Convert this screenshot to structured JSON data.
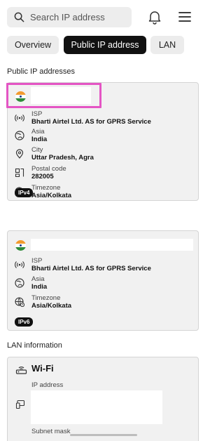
{
  "search": {
    "placeholder": "Search IP address"
  },
  "tabs": [
    {
      "label": "Overview",
      "active": false
    },
    {
      "label": "Public IP address",
      "active": true
    },
    {
      "label": "LAN",
      "active": false
    }
  ],
  "public_section": {
    "title": "Public IP addresses"
  },
  "ipv4_card": {
    "rows": [
      {
        "icon": "isp-icon",
        "label": "ISP",
        "value": "Bharti Airtel Ltd. AS for GPRS Service"
      },
      {
        "icon": "globe-icon",
        "label": "Asia",
        "value": "India"
      },
      {
        "icon": "location-pin-icon",
        "label": "City",
        "value": "Uttar Pradesh, Agra"
      },
      {
        "icon": "postal-code-icon",
        "label": "Postal code",
        "value": "282005"
      },
      {
        "icon": "timezone-icon",
        "label": "Timezone",
        "value": "Asia/Kolkata"
      }
    ],
    "badge": "IPv4"
  },
  "ipv6_card": {
    "rows": [
      {
        "icon": "isp-icon",
        "label": "ISP",
        "value": "Bharti Airtel Ltd. AS for GPRS Service"
      },
      {
        "icon": "globe-icon",
        "label": "Asia",
        "value": "India"
      },
      {
        "icon": "timezone-icon",
        "label": "Timezone",
        "value": "Asia/Kolkata"
      }
    ],
    "badge": "IPv6"
  },
  "lan_section": {
    "title": "LAN information"
  },
  "wifi_card": {
    "title": "Wi-Fi",
    "ip_label": "IP address",
    "subnet_label": "Subnet mask"
  },
  "colors": {
    "highlight": "#e455c4",
    "active_tab": "#111111"
  }
}
